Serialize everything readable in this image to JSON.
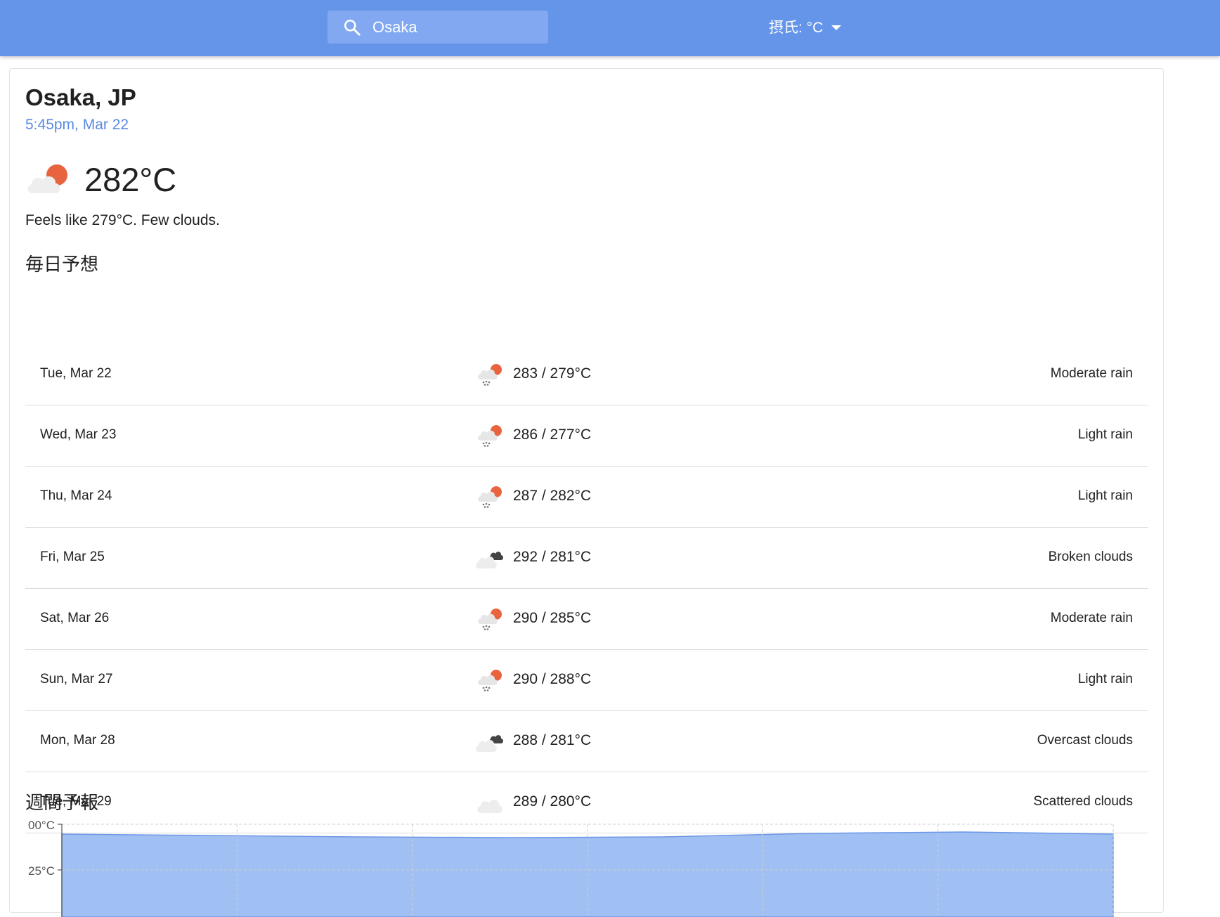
{
  "header": {
    "search": {
      "value": "Osaka",
      "placeholder": ""
    },
    "units_label": "摂氏: °C"
  },
  "current": {
    "location": "Osaka, JP",
    "datetime": "5:45pm, Mar 22",
    "temperature": "282°C",
    "icon": "few-clouds-day-icon",
    "summary": "Feels like 279°C. Few clouds."
  },
  "daily_title": "毎日予想",
  "daily": [
    {
      "date": "Tue, Mar 22",
      "icon": "rain-day-icon",
      "range": "283 / 279°C",
      "description": "Moderate rain"
    },
    {
      "date": "Wed, Mar 23",
      "icon": "rain-day-icon",
      "range": "286 / 277°C",
      "description": "Light rain"
    },
    {
      "date": "Thu, Mar 24",
      "icon": "rain-day-icon",
      "range": "287 / 282°C",
      "description": "Light rain"
    },
    {
      "date": "Fri, Mar 25",
      "icon": "broken-clouds-icon",
      "range": "292 / 281°C",
      "description": "Broken clouds"
    },
    {
      "date": "Sat, Mar 26",
      "icon": "rain-day-icon",
      "range": "290 / 285°C",
      "description": "Moderate rain"
    },
    {
      "date": "Sun, Mar 27",
      "icon": "rain-day-icon",
      "range": "290 / 288°C",
      "description": "Light rain"
    },
    {
      "date": "Mon, Mar 28",
      "icon": "broken-clouds-icon",
      "range": "288 / 281°C",
      "description": "Overcast clouds"
    },
    {
      "date": "Tue, Mar 29",
      "icon": "cloud-icon",
      "range": "289 / 280°C",
      "description": "Scattered clouds"
    }
  ],
  "weekly_title": "週間予報",
  "colors": {
    "header": "#6495e9",
    "accent": "#5a8ae0",
    "sun": "#e8643f",
    "chart_fill": "#a0bff2",
    "chart_line": "#6b97e6"
  },
  "chart_data": {
    "type": "area",
    "ytick_labels": [
      "00°C",
      "25°C"
    ],
    "grid": true
  }
}
